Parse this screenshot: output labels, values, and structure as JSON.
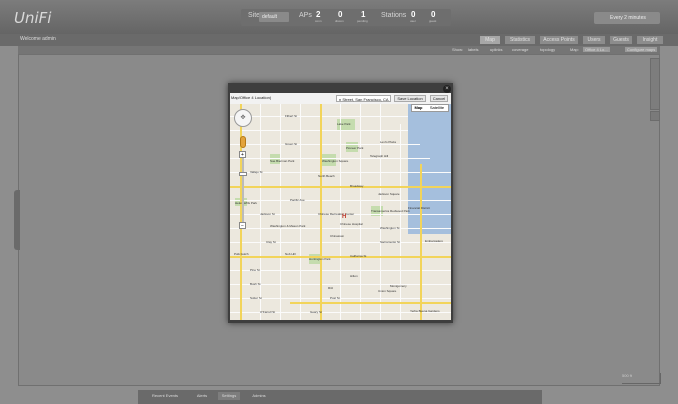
{
  "app": {
    "logo": "UniFi"
  },
  "header": {
    "site_label": "Site",
    "site_value": "default",
    "aps_label": "APs",
    "aps_connected": "2",
    "aps_disconnected": "0",
    "aps_pending": "1",
    "stations_label": "Stations",
    "stations_user": "0",
    "stations_guest": "0",
    "sub_connected": "conn",
    "sub_disconnected": "discon",
    "sub_pending": "pending",
    "sub_user": "user",
    "sub_guest": "guest",
    "user_select": "Every 2 minutes"
  },
  "nav": {
    "welcome": "Welcome admin",
    "tabs": [
      "Map",
      "Statistics",
      "Access Points",
      "Users",
      "Guests",
      "Insight"
    ]
  },
  "map_toolbar": {
    "items": [
      "Show:",
      "labels",
      "uplinks",
      "coverage",
      "topology"
    ],
    "map_label": "Map:",
    "map_select": "Office 4 Lo...",
    "configure_maps": "Configure maps"
  },
  "modal": {
    "location_label": "Map/Office 4 Location)",
    "address_value": "n Street, San Francisco, CA",
    "save_location": "Save Location",
    "cancel": "Cancel",
    "maptype_map": "Map",
    "maptype_satellite": "Satellite",
    "map_labels": [
      "Lake Park",
      "Levi's Plaza",
      "Pioneer Park",
      "Washington Square",
      "Helen Wills Park",
      "Sue Bierman Park",
      "Chinese Recreation Center",
      "Chinese Hospital",
      "Transamerica Redwood Park",
      "Washington & Mason Park",
      "Huntington Park",
      "Hilton",
      "Union Square",
      "Ritz",
      "Yerba Buena Gardens",
      "Jackson Square",
      "Financial District",
      "Embarcadero",
      "Filbert St",
      "Green St",
      "Vallejo St",
      "Broadway",
      "Pacific Ave",
      "Jackson St",
      "Washington St",
      "Clay St",
      "Sacramento St",
      "California St",
      "Pine St",
      "Bush St",
      "Sutter St",
      "Post St",
      "Geary St",
      "O'Farrell St",
      "Polk Gulch",
      "Nob Hill",
      "Chinatown",
      "North Beach",
      "Telegraph Hill",
      "Montgomery"
    ]
  },
  "bottom": {
    "tabs": [
      "Recent Events",
      "Alerts",
      "Settings",
      "Admins"
    ]
  },
  "scale": {
    "label": "500 ft"
  }
}
